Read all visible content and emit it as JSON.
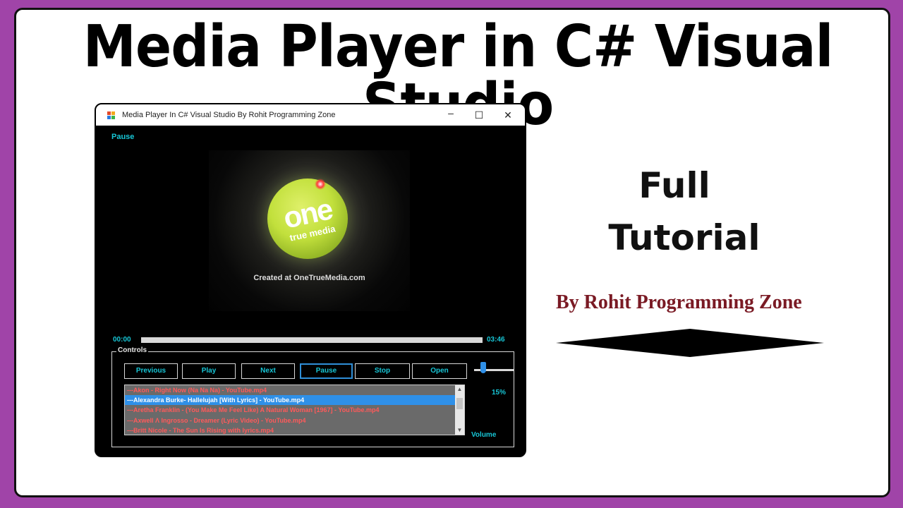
{
  "page": {
    "title": "Media Player in C# Visual Studio",
    "side": {
      "line1": "Full",
      "line2": "Tutorial",
      "byline": "By Rohit Programming Zone"
    }
  },
  "window": {
    "title": "Media Player In C# Visual Studio By Rohit Programming Zone",
    "min_icon": "minimize-icon",
    "max_icon": "maximize-icon",
    "close_icon": "close-icon"
  },
  "player": {
    "status": "Pause",
    "video_caption": "Created at OneTrueMedia.com",
    "logo_big": "one",
    "logo_small": "true media",
    "current_time": "00:00",
    "duration": "03:46",
    "progress": 0.0
  },
  "controls": {
    "group_label": "Controls",
    "buttons": [
      {
        "label": "Previous"
      },
      {
        "label": "Play"
      },
      {
        "label": "Next"
      },
      {
        "label": "Pause"
      },
      {
        "label": "Stop"
      },
      {
        "label": "Open"
      }
    ],
    "volume_percent_label": "15%",
    "volume_level": 0.15,
    "volume_label": "Volume"
  },
  "playlist": {
    "items": [
      "---Akon - Right Now (Na Na Na) - YouTube.mp4",
      "---Alexandra Burke- Hallelujah [With Lyrics] - YouTube.mp4",
      "---Aretha Franklin - (You Make Me Feel Like) A Natural Woman [1967] - YouTube.mp4",
      "---Axwell Λ Ingrosso - Dreamer (Lyric Video) - YouTube.mp4",
      "---Britt Nicole - The Sun Is Rising with lyrics.mp4"
    ],
    "selected_index": 1
  },
  "colors": {
    "background": "#a044a8",
    "accent": "#17c6d6",
    "selection": "#2f90e8",
    "list_text": "#ff5a5a",
    "byline": "#7a1a24"
  }
}
